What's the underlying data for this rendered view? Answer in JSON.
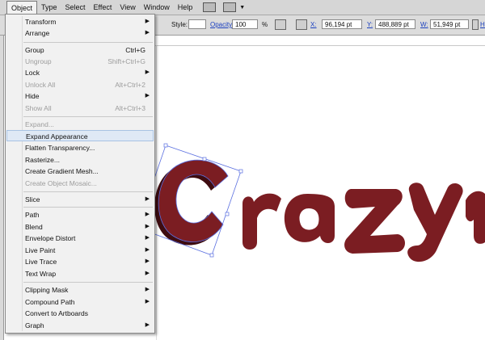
{
  "menubar": {
    "items": [
      {
        "label": "Object",
        "active": true
      },
      {
        "label": "Type"
      },
      {
        "label": "Select"
      },
      {
        "label": "Effect"
      },
      {
        "label": "View"
      },
      {
        "label": "Window"
      },
      {
        "label": "Help"
      }
    ],
    "icons": [
      "bridge-icon",
      "arrange-documents-icon"
    ]
  },
  "controlbar": {
    "style_label": "Style:",
    "opacity_label": "Opacity:",
    "opacity_value": "100",
    "opacity_unit": "%",
    "x_label": "X:",
    "x_value": "96,194 pt",
    "y_label": "Y:",
    "y_value": "488,889 pt",
    "w_label": "W:",
    "w_value": "51,949 pt",
    "h_label": "H:"
  },
  "object_menu": {
    "items": [
      {
        "label": "Transform",
        "submenu": true
      },
      {
        "label": "Arrange",
        "submenu": true
      },
      {
        "label": "Group",
        "shortcut": "Ctrl+G"
      },
      {
        "label": "Ungroup",
        "shortcut": "Shift+Ctrl+G",
        "disabled": true
      },
      {
        "label": "Lock",
        "submenu": true
      },
      {
        "label": "Unlock All",
        "shortcut": "Alt+Ctrl+2",
        "disabled": true
      },
      {
        "label": "Hide",
        "submenu": true
      },
      {
        "label": "Show All",
        "shortcut": "Alt+Ctrl+3",
        "disabled": true
      },
      {
        "label": "Expand...",
        "disabled": true
      },
      {
        "label": "Expand Appearance",
        "highlighted": true
      },
      {
        "label": "Flatten Transparency..."
      },
      {
        "label": "Rasterize..."
      },
      {
        "label": "Create Gradient Mesh..."
      },
      {
        "label": "Create Object Mosaic...",
        "disabled": true
      },
      {
        "label": "Slice",
        "submenu": true
      },
      {
        "label": "Path",
        "submenu": true
      },
      {
        "label": "Blend",
        "submenu": true
      },
      {
        "label": "Envelope Distort",
        "submenu": true
      },
      {
        "label": "Live Paint",
        "submenu": true
      },
      {
        "label": "Live Trace",
        "submenu": true
      },
      {
        "label": "Text Wrap",
        "submenu": true
      },
      {
        "label": "Clipping Mask",
        "submenu": true
      },
      {
        "label": "Compound Path",
        "submenu": true
      },
      {
        "label": "Convert to Artboards"
      },
      {
        "label": "Graph",
        "submenu": true
      }
    ]
  },
  "artwork": {
    "text": "Crazy",
    "fill_color": "#7b1d22",
    "shadow_color": "#3e0c10",
    "selection_color": "#5a6fe0"
  }
}
